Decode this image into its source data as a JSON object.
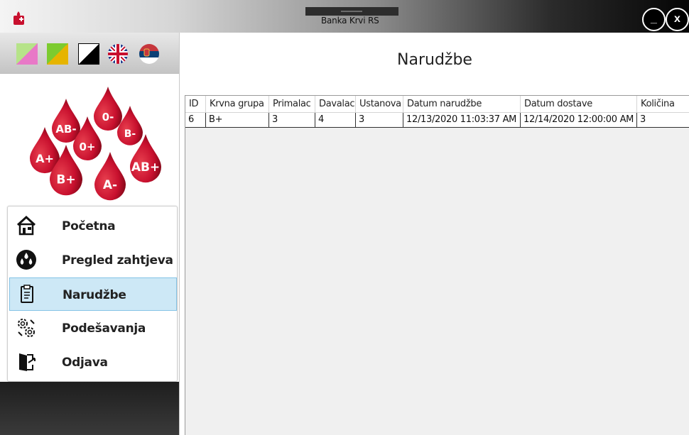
{
  "window": {
    "title": "Banka Krvi RS",
    "minimize_label": "_",
    "close_label": "x"
  },
  "sidebar": {
    "nav": [
      {
        "label": "Početna",
        "icon": "home-icon"
      },
      {
        "label": "Pregled zahtjeva",
        "icon": "blood-drops-icon"
      },
      {
        "label": "Narudžbe",
        "icon": "clipboard-icon",
        "selected": true
      },
      {
        "label": "Podešavanja",
        "icon": "settings-gears-icon"
      },
      {
        "label": "Odjava",
        "icon": "logout-door-icon"
      }
    ],
    "themes": [
      {
        "name": "theme-pink-green",
        "colors": [
          "#b6e389",
          "#e879c7"
        ]
      },
      {
        "name": "theme-green-yellow",
        "colors": [
          "#7ccb2f",
          "#e6b400"
        ]
      },
      {
        "name": "theme-black-white",
        "colors": [
          "#ffffff",
          "#000000"
        ]
      }
    ],
    "languages": [
      {
        "icon": "flag-uk-icon"
      },
      {
        "icon": "flag-serbia-icon"
      }
    ],
    "blood_types": [
      "AB-",
      "0-",
      "B-",
      "A+",
      "0+",
      "AB+",
      "B+",
      "A-"
    ]
  },
  "main": {
    "title": "Narudžbe",
    "table": {
      "columns": [
        "ID",
        "Krvna grupa",
        "Primalac",
        "Davalac",
        "Ustanova",
        "Datum narudžbe",
        "Datum dostave",
        "Količina"
      ],
      "rows": [
        [
          "6",
          "B+",
          "3",
          "4",
          "3",
          "12/13/2020 11:03:37 AM",
          "12/14/2020 12:00:00 AM",
          "3"
        ]
      ]
    }
  },
  "colors": {
    "accent_selected": "#cde8f6",
    "blood": "#c8102e"
  }
}
